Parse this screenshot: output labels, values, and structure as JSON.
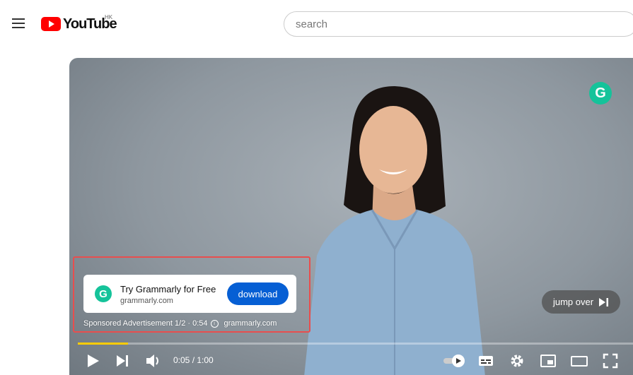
{
  "header": {
    "logo_text": "YouTube",
    "region": "HK",
    "search_placeholder": "search"
  },
  "ad": {
    "title": "Try Grammarly for Free",
    "domain": "grammarly.com",
    "cta_label": "download",
    "sponsored_text": "Sponsored Advertisement 1/2 · 0:54",
    "sponsored_domain": "grammarly.com",
    "brand_letter": "G",
    "brand_color": "#15c39a",
    "cta_color": "#065fd4",
    "highlight_color": "#e84e4e"
  },
  "player": {
    "skip_label": "jump over",
    "time": "0:05 / 1:00",
    "progress_fraction": 0.09,
    "progress_color": "#ffcc00",
    "icons": [
      "play-icon",
      "next-icon",
      "volume-icon",
      "autoplay-toggle-icon",
      "subtitles-icon",
      "settings-icon",
      "miniplayer-icon",
      "theater-icon",
      "fullscreen-icon"
    ]
  }
}
